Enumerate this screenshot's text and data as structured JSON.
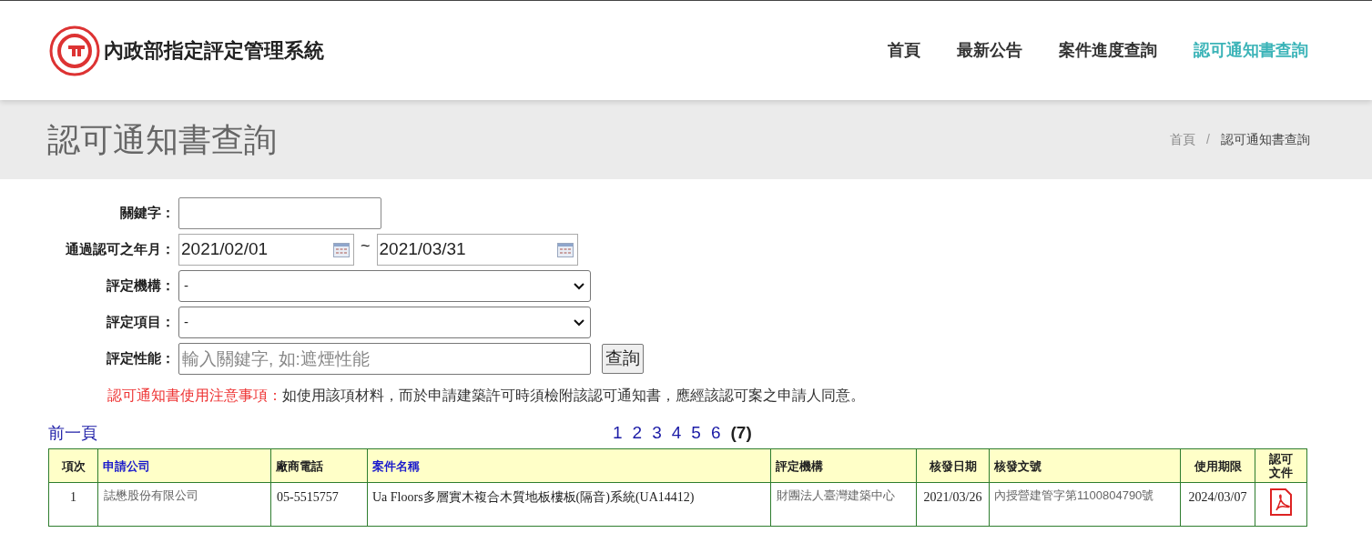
{
  "header": {
    "site_title": "內政部指定評定管理系統",
    "nav": [
      {
        "label": "首頁",
        "selected": false
      },
      {
        "label": "最新公告",
        "selected": false
      },
      {
        "label": "案件進度查詢",
        "selected": false
      },
      {
        "label": "認可通知書查詢",
        "selected": true
      }
    ]
  },
  "page": {
    "title": "認可通知書查詢",
    "breadcrumb": [
      "首頁",
      "認可通知書查詢"
    ],
    "breadcrumb_separator": "/"
  },
  "form": {
    "keyword": {
      "label": "關鍵字："
    },
    "date_range": {
      "label": "通過認可之年月：",
      "from": "2021/02/01",
      "separator": "~",
      "to": "2021/03/31"
    },
    "agency": {
      "label": "評定機構：",
      "value": "-"
    },
    "item": {
      "label": "評定項目：",
      "value": "-"
    },
    "performance": {
      "label": "評定性能：",
      "placeholder": "輸入關鍵字, 如:遮煙性能"
    },
    "search_button": "查詢"
  },
  "notice": {
    "title": "認可通知書使用注意事項：",
    "text": "如使用該項材料，而於申請建築許可時須檢附該認可通知書，應經該認可案之申請人同意。"
  },
  "pagination": {
    "prev": "前一頁",
    "pages": [
      {
        "label": "1",
        "selected": false
      },
      {
        "label": "2",
        "selected": false
      },
      {
        "label": "3",
        "selected": false
      },
      {
        "label": "4",
        "selected": false
      },
      {
        "label": "5",
        "selected": false
      },
      {
        "label": "6",
        "selected": false
      },
      {
        "label": "7",
        "selected": true
      }
    ],
    "open_paren": "(",
    "close_paren": ")"
  },
  "table": {
    "columns": [
      {
        "label": "項次",
        "kind": "plain"
      },
      {
        "label": "申請公司",
        "kind": "link"
      },
      {
        "label": "廠商電話",
        "kind": "plain"
      },
      {
        "label": "案件名稱",
        "kind": "link"
      },
      {
        "label": "評定機構",
        "kind": "plain"
      },
      {
        "label": "核發日期",
        "kind": "plain"
      },
      {
        "label": "核發文號",
        "kind": "plain"
      },
      {
        "label": "使用期限",
        "kind": "plain"
      },
      {
        "label": "認可文件",
        "kind": "plain"
      }
    ],
    "rows": [
      {
        "index": "1",
        "company": "誌懋股份有限公司",
        "phone": "05-5515757",
        "case_name": "Ua Floors多層實木複合木質地板樓板(隔音)系統(UA14412)",
        "agency": "財團法人臺灣建築中心",
        "date": "2021/03/26",
        "doc_no": "內授營建管字第1100804790號",
        "expiry": "2024/03/07"
      }
    ]
  }
}
